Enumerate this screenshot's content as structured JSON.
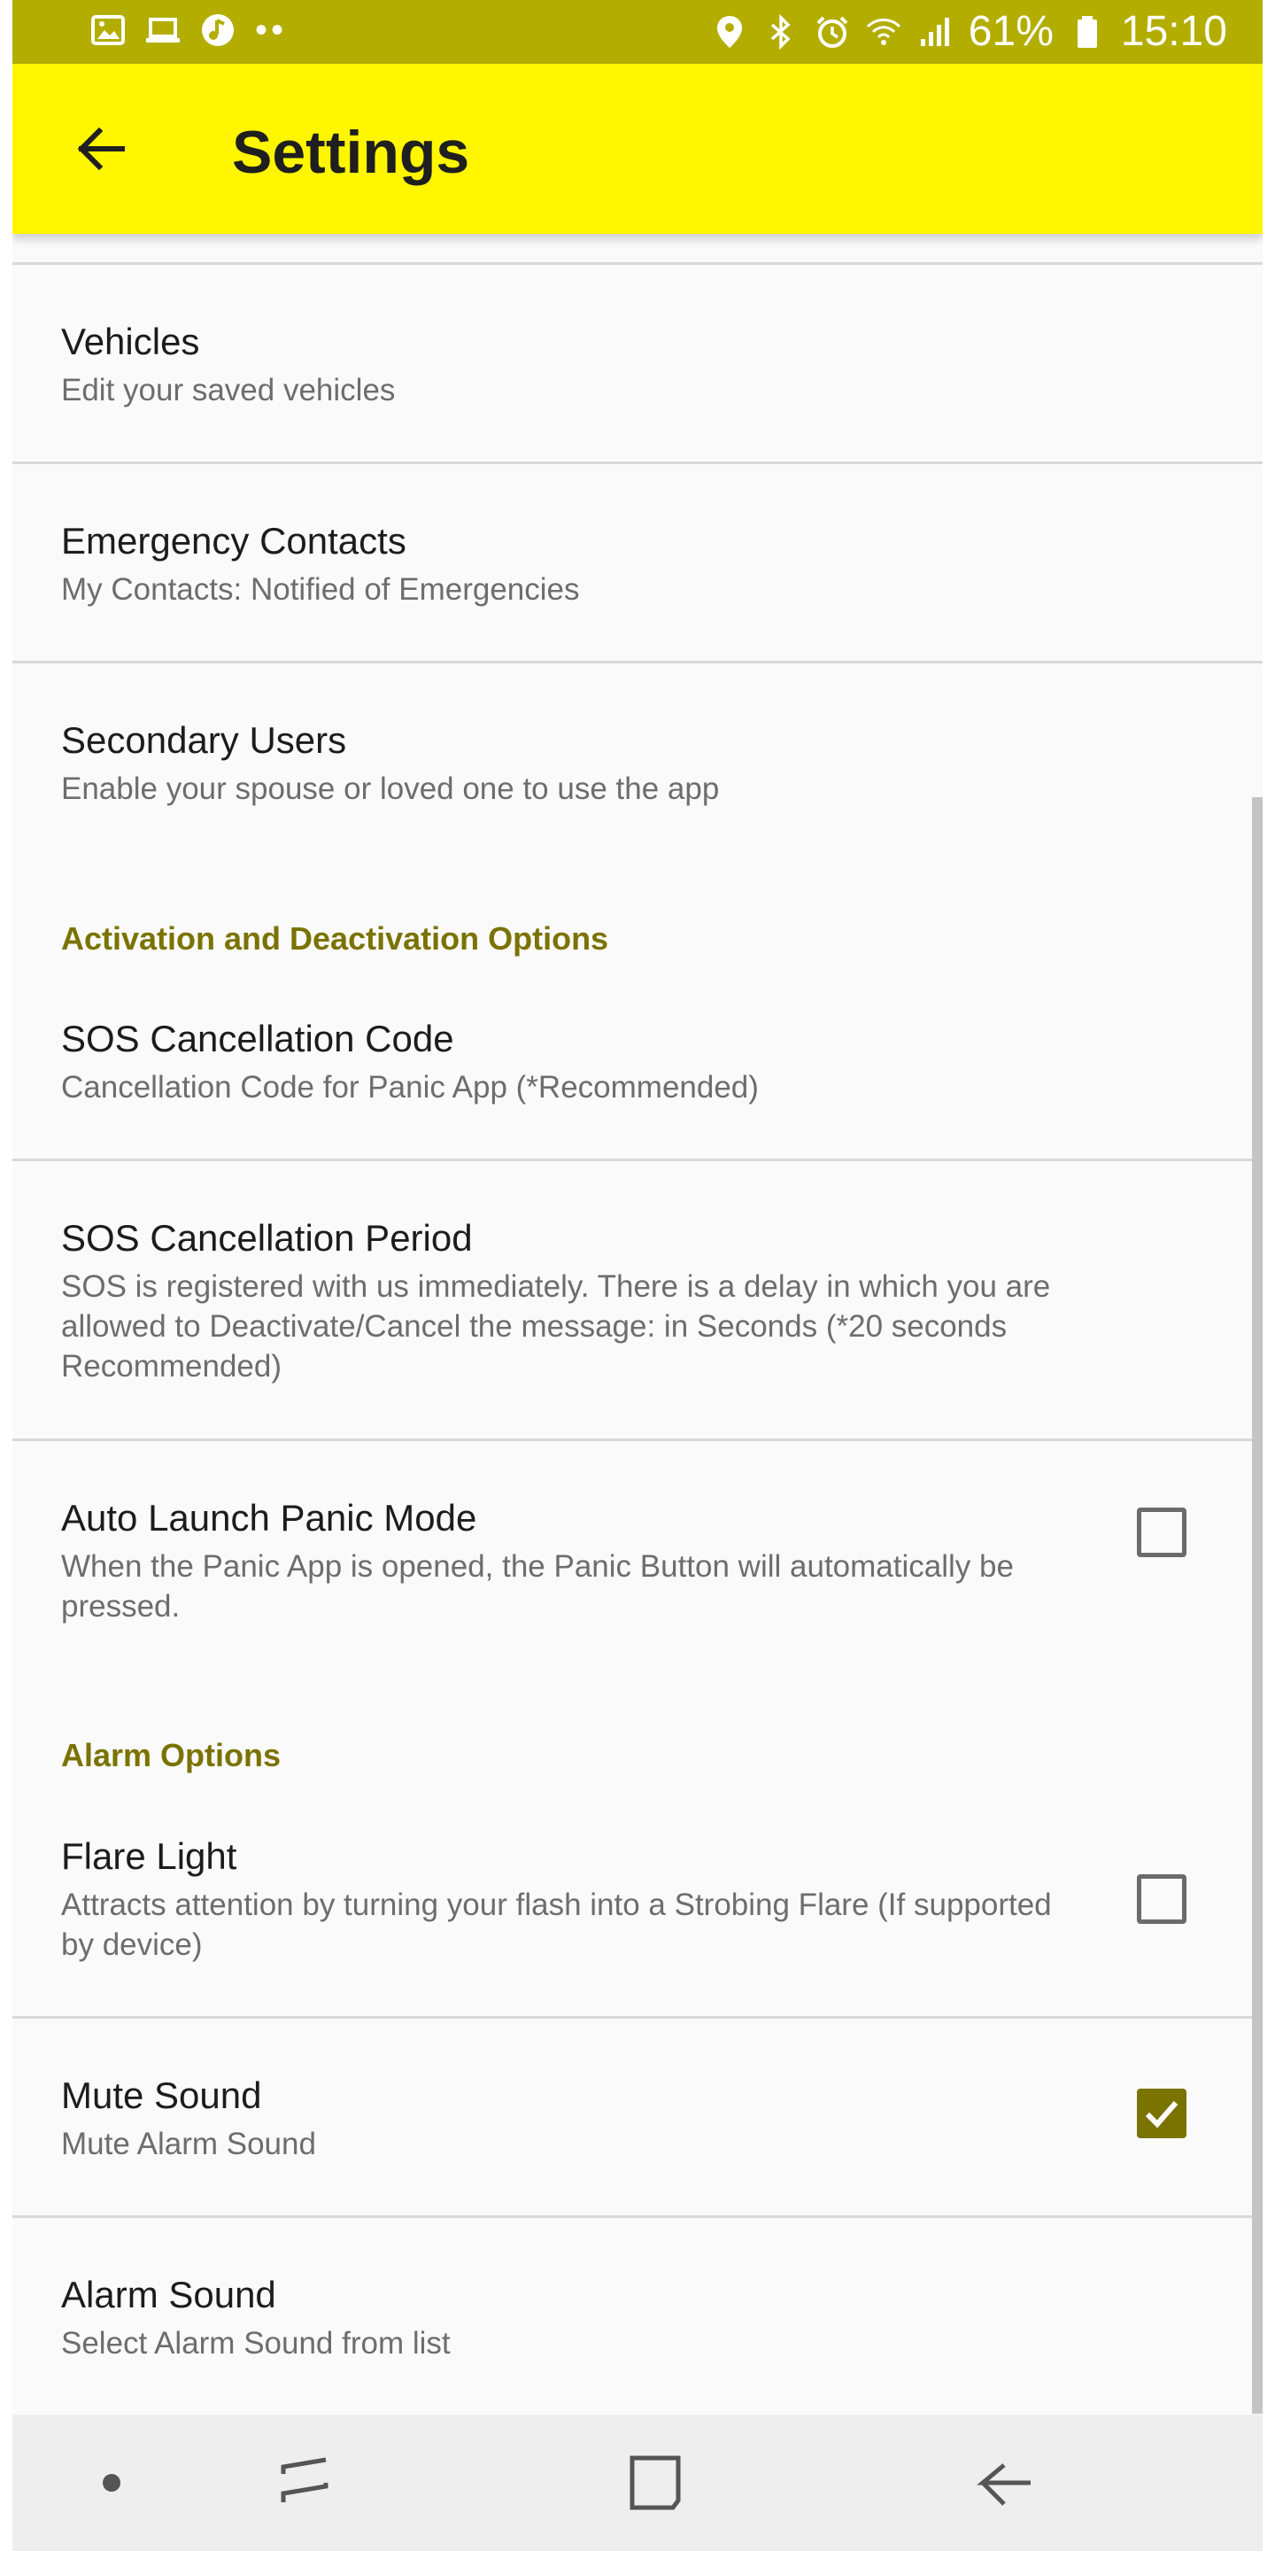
{
  "status_bar": {
    "battery": "61%",
    "time": "15:10",
    "left_icons": [
      "image-icon",
      "laptop-icon",
      "music-icon",
      "more-dots-icon"
    ],
    "right_icons": [
      "location-icon",
      "bluetooth-icon",
      "alarm-icon",
      "wifi-icon",
      "signal-icon",
      "battery-icon"
    ],
    "background": "#b3ad00"
  },
  "toolbar": {
    "title": "Settings",
    "back_icon": "arrow-back-icon",
    "background": "#fff600"
  },
  "items": [
    {
      "title": "Vehicles",
      "subtitle": "Edit your saved vehicles"
    },
    {
      "title": "Emergency Contacts",
      "subtitle": "My Contacts: Notified of Emergencies"
    },
    {
      "title": "Secondary Users",
      "subtitle": "Enable your spouse or loved one to use the app"
    },
    {
      "title": "SOS Cancellation Code",
      "subtitle": "Cancellation Code for Panic App (*Recommended)"
    },
    {
      "title": "SOS Cancellation Period",
      "subtitle": "SOS is registered with us immediately. There is a delay in which you are allowed to Deactivate/Cancel the message: in Seconds (*20 seconds Recommended)"
    },
    {
      "title": "Auto Launch Panic Mode",
      "subtitle": "When the Panic App is opened, the Panic Button will automatically be pressed.",
      "checked": false
    },
    {
      "title": "Flare Light",
      "subtitle": "Attracts attention by turning your flash into a Strobing Flare (If supported by device)",
      "checked": false
    },
    {
      "title": "Mute Sound",
      "subtitle": "Mute Alarm Sound",
      "checked": true
    },
    {
      "title": "Alarm Sound",
      "subtitle": "Select Alarm Sound from list"
    }
  ],
  "sections": {
    "activation": "Activation and Deactivation Options",
    "alarm": "Alarm Options"
  },
  "accent_color": "#7a7300",
  "nav_bar": {
    "buttons": [
      "dot-icon",
      "recent-apps-icon",
      "home-icon",
      "back-icon"
    ]
  }
}
